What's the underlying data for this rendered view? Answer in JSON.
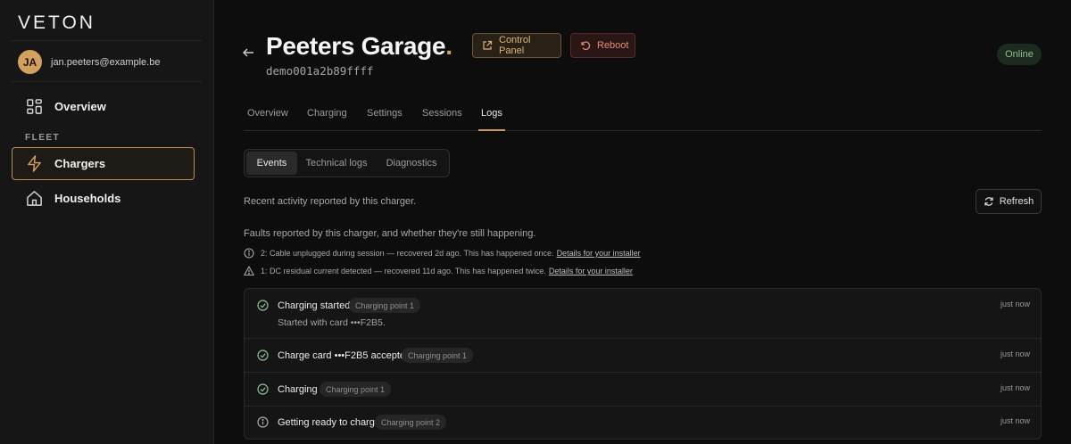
{
  "sidebar": {
    "logo": "VETON",
    "user": {
      "initials": "JA",
      "email": "jan.peeters@example.be"
    },
    "overview": "Overview",
    "section_label": "FLEET",
    "chargers": "Chargers",
    "households": "Households"
  },
  "header": {
    "title": "Peeters Garage",
    "title_dot": ".",
    "device_id": "demo001a2b89ffff",
    "control_panel": "Control Panel",
    "reboot": "Reboot",
    "status": "Online"
  },
  "tabs": [
    "Overview",
    "Charging",
    "Settings",
    "Sessions",
    "Logs"
  ],
  "active_tab": "Logs",
  "subtabs": [
    "Events",
    "Technical logs",
    "Diagnostics"
  ],
  "active_subtab": "Events",
  "description": "Recent activity reported by this charger.",
  "refresh": "Refresh",
  "faults": {
    "title": "Faults reported by this charger, and whether they're still happening.",
    "items": [
      {
        "icon": "info-icon",
        "text": "2: Cable unplugged during session — recovered 2d ago. This has happened once.",
        "link": "Details for your installer"
      },
      {
        "icon": "warning-icon",
        "text": "1: DC residual current detected — recovered 11d ago. This has happened twice.",
        "link": "Details for your installer"
      }
    ]
  },
  "events": [
    {
      "icon": "check-circle-icon",
      "title": "Charging started",
      "chip": "Charging point 1",
      "sub": "Started with card •••F2B5.",
      "time": "just now"
    },
    {
      "icon": "check-circle-icon",
      "title": "Charge card •••F2B5 accepted",
      "chip": "Charging point 1",
      "sub": "",
      "time": "just now"
    },
    {
      "icon": "check-circle-icon",
      "title": "Charging",
      "chip": "Charging point 1",
      "sub": "",
      "time": "just now"
    },
    {
      "icon": "info-circle-icon",
      "title": "Getting ready to charge",
      "chip": "Charging point 2",
      "sub": "",
      "time": "just now"
    }
  ],
  "colors": {
    "accent": "#d3a15f",
    "online": "#8fbf94",
    "reboot": "#e08c7a"
  }
}
